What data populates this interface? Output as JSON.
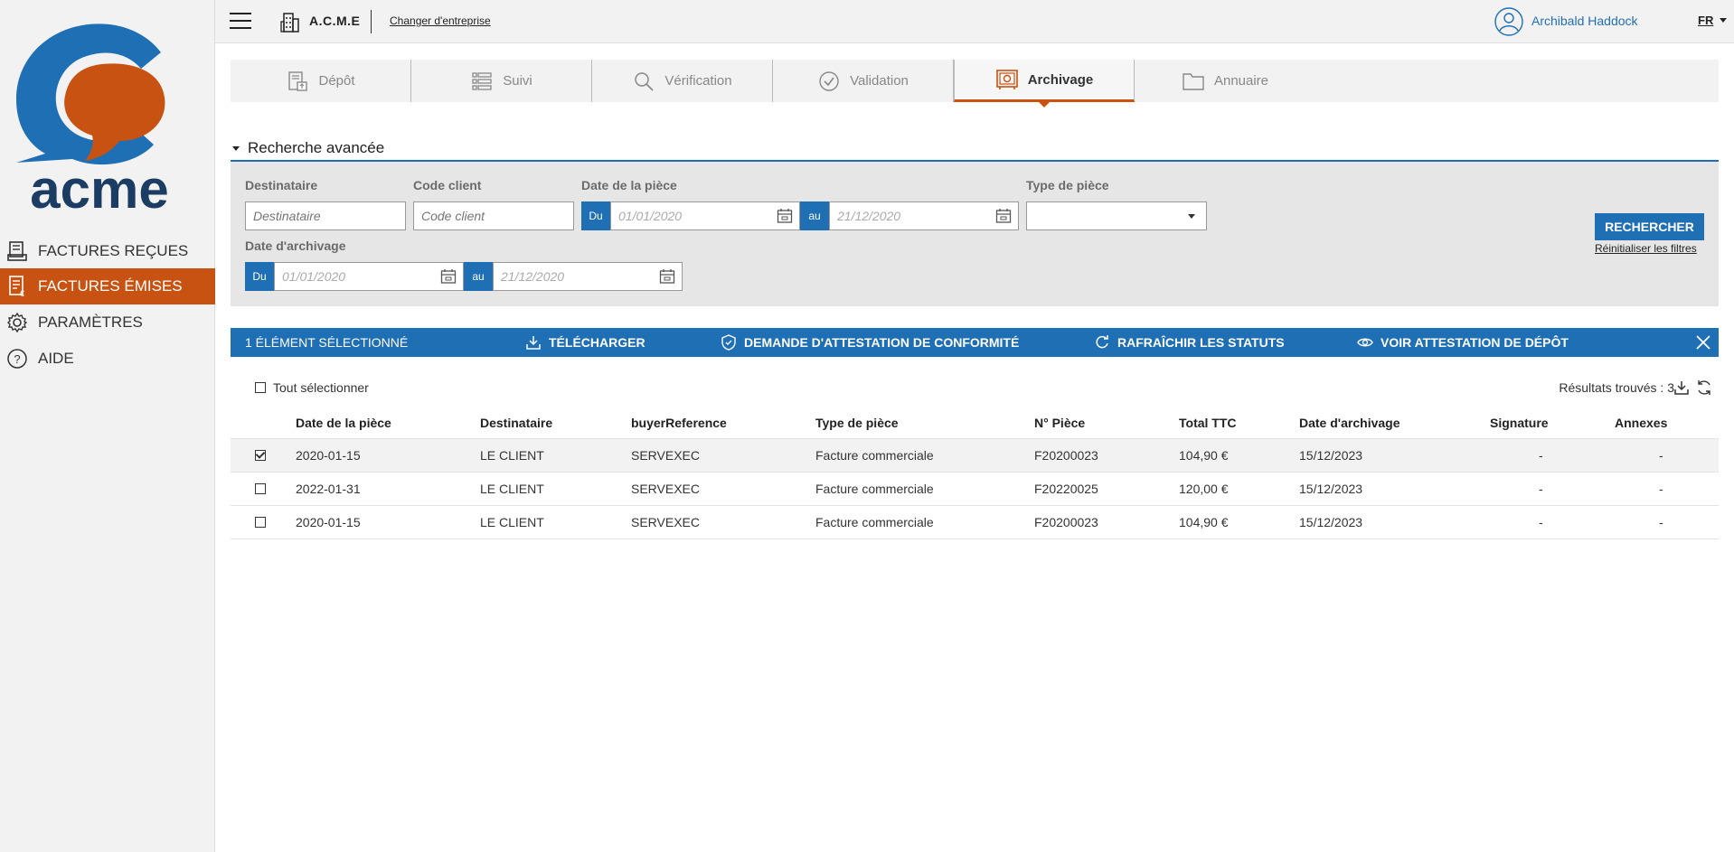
{
  "brand": {
    "logo_text": "acme",
    "primary": "#1f6fb5",
    "accent": "#c85211"
  },
  "sidebar": {
    "items": [
      {
        "label": "FACTURES REÇUES",
        "icon": "invoice-received-icon",
        "active": false
      },
      {
        "label": "FACTURES ÉMISES",
        "icon": "invoice-issued-icon",
        "active": true
      },
      {
        "label": "PARAMÈTRES",
        "icon": "gear-icon",
        "active": false
      },
      {
        "label": "AIDE",
        "icon": "help-icon",
        "active": false
      }
    ]
  },
  "topbar": {
    "company": "A.C.M.E",
    "change_company": "Changer d'entreprise",
    "user": "Archibald Haddock",
    "lang": "FR"
  },
  "tabs": [
    {
      "label": "Dépôt",
      "icon": "upload-doc-icon",
      "active": false
    },
    {
      "label": "Suivi",
      "icon": "list-icon",
      "active": false
    },
    {
      "label": "Vérification",
      "icon": "search-icon",
      "active": false
    },
    {
      "label": "Validation",
      "icon": "check-circle-icon",
      "active": false
    },
    {
      "label": "Archivage",
      "icon": "safe-icon",
      "active": true
    },
    {
      "label": "Annuaire",
      "icon": "folder-icon",
      "active": false
    }
  ],
  "search": {
    "title": "Recherche avancée",
    "destinataire_label": "Destinataire",
    "destinataire_placeholder": "Destinataire",
    "code_client_label": "Code client",
    "code_client_placeholder": "Code client",
    "date_piece_label": "Date de la pièce",
    "date_piece_from": "01/01/2020",
    "date_piece_to": "21/12/2020",
    "type_piece_label": "Type de pièce",
    "type_piece_value": "",
    "date_archivage_label": "Date d'archivage",
    "date_archivage_from": "01/01/2020",
    "date_archivage_to": "21/12/2020",
    "du": "Du",
    "au": "au",
    "search_button": "RECHERCHER",
    "reset_link": "Réinitialiser les filtres"
  },
  "action_bar": {
    "selected": "1 ÉLÉMENT SÉLECTIONNÉ",
    "download": "TÉLÉCHARGER",
    "attestation_request": "DEMANDE D'ATTESTATION DE CONFORMITÉ",
    "refresh_status": "RAFRAÎCHIR LES STATUTS",
    "view_attestation": "VOIR ATTESTATION DE DÉPÔT"
  },
  "table": {
    "select_all": "Tout sélectionner",
    "results": "Résultats trouvés : 3",
    "columns": [
      "Date de la pièce",
      "Destinataire",
      "buyerReference",
      "Type de pièce",
      "N° Pièce",
      "Total TTC",
      "Date d'archivage",
      "Signature",
      "Annexes"
    ],
    "rows": [
      {
        "checked": true,
        "cells": [
          "2020-01-15",
          "LE CLIENT",
          "SERVEXEC",
          "Facture commerciale",
          "F20200023",
          "104,90 €",
          "15/12/2023",
          "-",
          "-"
        ]
      },
      {
        "checked": false,
        "cells": [
          "2022-01-31",
          "LE CLIENT",
          "SERVEXEC",
          "Facture commerciale",
          "F20220025",
          "120,00 €",
          "15/12/2023",
          "-",
          "-"
        ]
      },
      {
        "checked": false,
        "cells": [
          "2020-01-15",
          "LE CLIENT",
          "SERVEXEC",
          "Facture commerciale",
          "F20200023",
          "104,90 €",
          "15/12/2023",
          "-",
          "-"
        ]
      }
    ]
  }
}
